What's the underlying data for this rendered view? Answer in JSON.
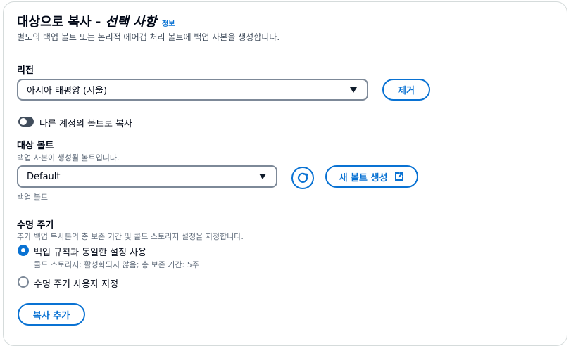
{
  "header": {
    "title_prefix": "대상으로 복사 - ",
    "title_italic": "선택 사항",
    "info_link": "정보",
    "description": "별도의 백업 볼트 또는 논리적 에어갭 처리 볼트에 백업 사본을 생성합니다."
  },
  "region": {
    "label": "리전",
    "selected": "아시아 태평양 (서울)",
    "remove_button": "제거"
  },
  "cross_account": {
    "label": "다른 계정의 볼트로 복사",
    "enabled": false
  },
  "vault": {
    "label": "대상 볼트",
    "description": "백업 사본이 생성될 볼트입니다.",
    "selected": "Default",
    "create_button": "새 볼트 생성",
    "hint": "백업 볼트"
  },
  "lifecycle": {
    "label": "수명 주기",
    "description": "추가 백업 복사본의 총 보존 기간 및 콜드 스토리지 설정을 지정합니다.",
    "options": [
      {
        "label": "백업 규칙과 동일한 설정 사용",
        "detail": "콜드 스토리지: 활성화되지 않음; 총 보존 기간: 5주",
        "selected": true
      },
      {
        "label": "수명 주기 사용자 지정",
        "selected": false
      }
    ]
  },
  "footer": {
    "add_copy_button": "복사 추가"
  },
  "colors": {
    "accent": "#0972d3",
    "text": "#000716",
    "muted": "#5f6b7a",
    "border": "#7d8998"
  }
}
